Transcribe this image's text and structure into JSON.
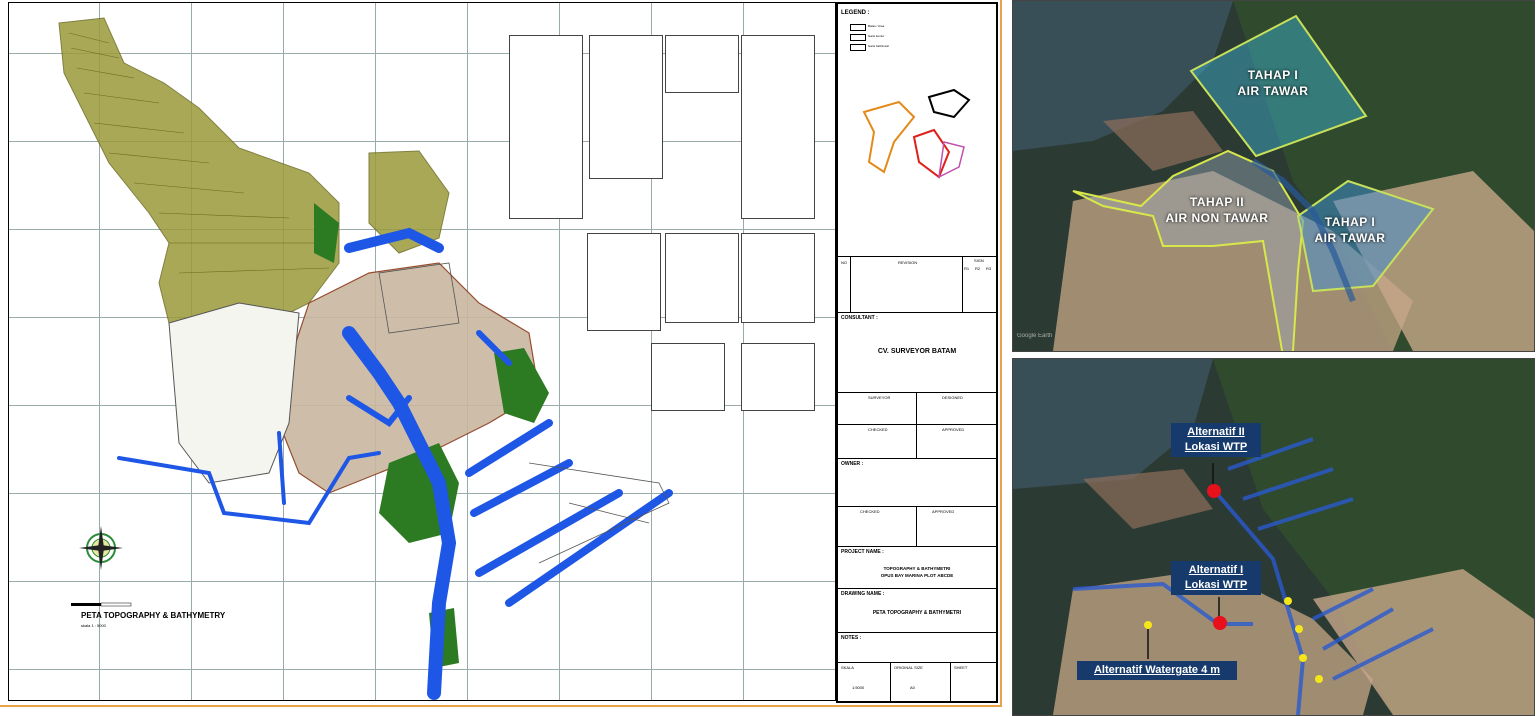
{
  "drawing": {
    "legend_title": "LEGEND :",
    "legend_items": [
      "Batas / Area",
      "Garis kontur",
      "Garis bathimetri"
    ],
    "map_title": "PETA TOPOGRAPHY & BATHYMETRY",
    "map_subtitle": "skala 1 : 5000",
    "title_block": {
      "no_label": "NO",
      "revision_label": "REVISION",
      "sign_label": "SIGN",
      "r1": "R1",
      "r2": "R2",
      "r3": "R3",
      "consultant_label": "CONSULTANT :",
      "consultant_name": "CV. SURVEYOR BATAM",
      "surveyor_label": "SURVEYOR",
      "designed_label": "DESIGNED",
      "checked_label": "CHECKED",
      "approved_label": "APPROVED",
      "owner_label": "OWNER :",
      "checked2_label": "CHECKED",
      "approved2_label": "APPROVED",
      "project_label": "PROJECT NAME :",
      "project_name_1": "TOPOGRAPHY & BATHYMETRI",
      "project_name_2": "OPUS BAY MARINA PLOT ABCDE",
      "drawing_label": "DRAWING NAME :",
      "drawing_name": "PETA TOPOGRAPHY & BATHYMETRI",
      "notes_label": "NOTES :",
      "skala_label": "SKALA",
      "original_size_label": "ORIGINAL SIZE",
      "sheet_label": "SHEET",
      "skala_value": "1:5000",
      "size_value": "A0"
    }
  },
  "satellite_top": {
    "zones": [
      {
        "line1": "TAHAP I",
        "line2": "AIR TAWAR"
      },
      {
        "line1": "TAHAP II",
        "line2": "AIR NON TAWAR"
      },
      {
        "line1": "TAHAP I",
        "line2": "AIR TAWAR"
      }
    ],
    "watermark": "Google Earth",
    "colors": {
      "tahap1": "#3fb8d8",
      "tahap2": "#d8e84a",
      "outline": "#c8e05a"
    }
  },
  "satellite_bottom": {
    "callouts": [
      {
        "line1": "Alternatif  II",
        "line2": "Lokasi WTP"
      },
      {
        "line1": "Alternatif  I",
        "line2": "Lokasi WTP"
      },
      {
        "line1": "Alternatif  Watergate 4 m"
      }
    ],
    "colors": {
      "wtp": "#e8101a",
      "watergate": "#f5e61a",
      "callout_bg": "#163a6b"
    }
  }
}
